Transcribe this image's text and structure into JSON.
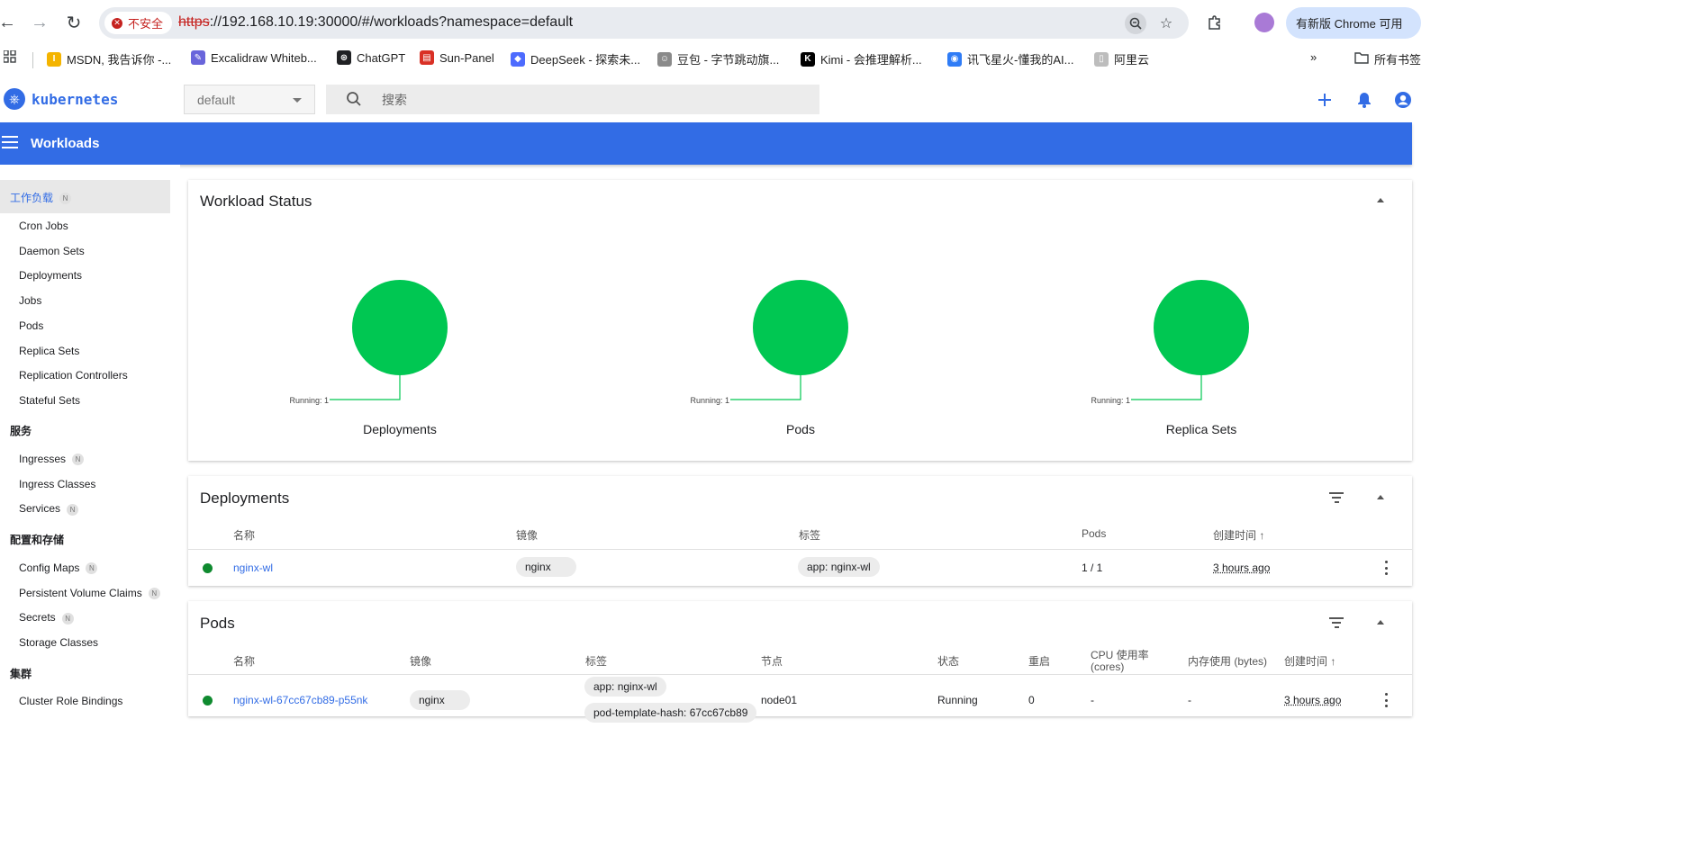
{
  "browser": {
    "security_label": "不安全",
    "url_protocol": "https",
    "url_rest": "://192.168.10.19:30000/#/workloads?namespace=default",
    "update_label": "有新版 Chrome 可用"
  },
  "bookmarks": [
    {
      "label": "MSDN, 我告诉你 -...",
      "color": "#f4b400",
      "glyph": "I"
    },
    {
      "label": "Excalidraw Whiteb...",
      "color": "#6965db",
      "glyph": "✎"
    },
    {
      "label": "ChatGPT",
      "color": "#202124",
      "glyph": "⊛"
    },
    {
      "label": "Sun-Panel",
      "color": "#d93025",
      "glyph": "▤"
    },
    {
      "label": "DeepSeek - 探索未...",
      "color": "#4d6bfe",
      "glyph": "◆"
    },
    {
      "label": "豆包 - 字节跳动旗...",
      "color": "#8a8a8a",
      "glyph": "☺"
    },
    {
      "label": "Kimi - 会推理解析...",
      "color": "#000000",
      "glyph": "K"
    },
    {
      "label": "讯飞星火-懂我的AI...",
      "color": "#2f7cf6",
      "glyph": "◉"
    },
    {
      "label": "阿里云",
      "color": "#bdbdbd",
      "glyph": "▯"
    }
  ],
  "bookmarks_all": "所有书签",
  "k8s": {
    "brand": "kubernetes",
    "namespace": "default",
    "search_placeholder": "搜索",
    "toolbar_title": "Workloads",
    "accent": "#326ce5"
  },
  "sidebar": {
    "active_label": "工作负载",
    "ns_badge": "N",
    "workload_items": [
      "Cron Jobs",
      "Daemon Sets",
      "Deployments",
      "Jobs",
      "Pods",
      "Replica Sets",
      "Replication Controllers",
      "Stateful Sets"
    ],
    "service_head": "服务",
    "service_items": [
      "Ingresses",
      "Ingress Classes",
      "Services"
    ],
    "config_head": "配置和存储",
    "config_items": [
      "Config Maps",
      "Persistent Volume Claims",
      "Secrets",
      "Storage Classes"
    ],
    "cluster_head": "集群",
    "cluster_items": [
      "Cluster Role Bindings"
    ]
  },
  "workload_status": {
    "title": "Workload Status",
    "charts": [
      {
        "name": "Deployments",
        "legend": "Running: 1",
        "running": 1
      },
      {
        "name": "Pods",
        "legend": "Running: 1",
        "running": 1
      },
      {
        "name": "Replica Sets",
        "legend": "Running: 1",
        "running": 1
      }
    ],
    "running_color": "#00c752"
  },
  "deployments": {
    "title": "Deployments",
    "headers": {
      "name": "名称",
      "image": "镜像",
      "labels": "标签",
      "pods": "Pods",
      "created": "创建时间"
    },
    "rows": [
      {
        "name": "nginx-wl",
        "image": "nginx",
        "label": "app: nginx-wl",
        "pods": "1 / 1",
        "created": "3 hours ago"
      }
    ]
  },
  "pods": {
    "title": "Pods",
    "headers": {
      "name": "名称",
      "image": "镜像",
      "labels": "标签",
      "node": "节点",
      "status": "状态",
      "restarts": "重启",
      "cpu": "CPU 使用率",
      "cpu_unit": "(cores)",
      "memory": "内存使用 (bytes)",
      "created": "创建时间"
    },
    "rows": [
      {
        "name": "nginx-wl-67cc67cb89-p55nk",
        "image": "nginx",
        "label1": "app: nginx-wl",
        "label2": "pod-template-hash: 67cc67cb89",
        "node": "node01",
        "status": "Running",
        "restarts": "0",
        "cpu": "-",
        "memory": "-",
        "created": "3 hours ago"
      }
    ]
  },
  "sort_arrow": "↑"
}
